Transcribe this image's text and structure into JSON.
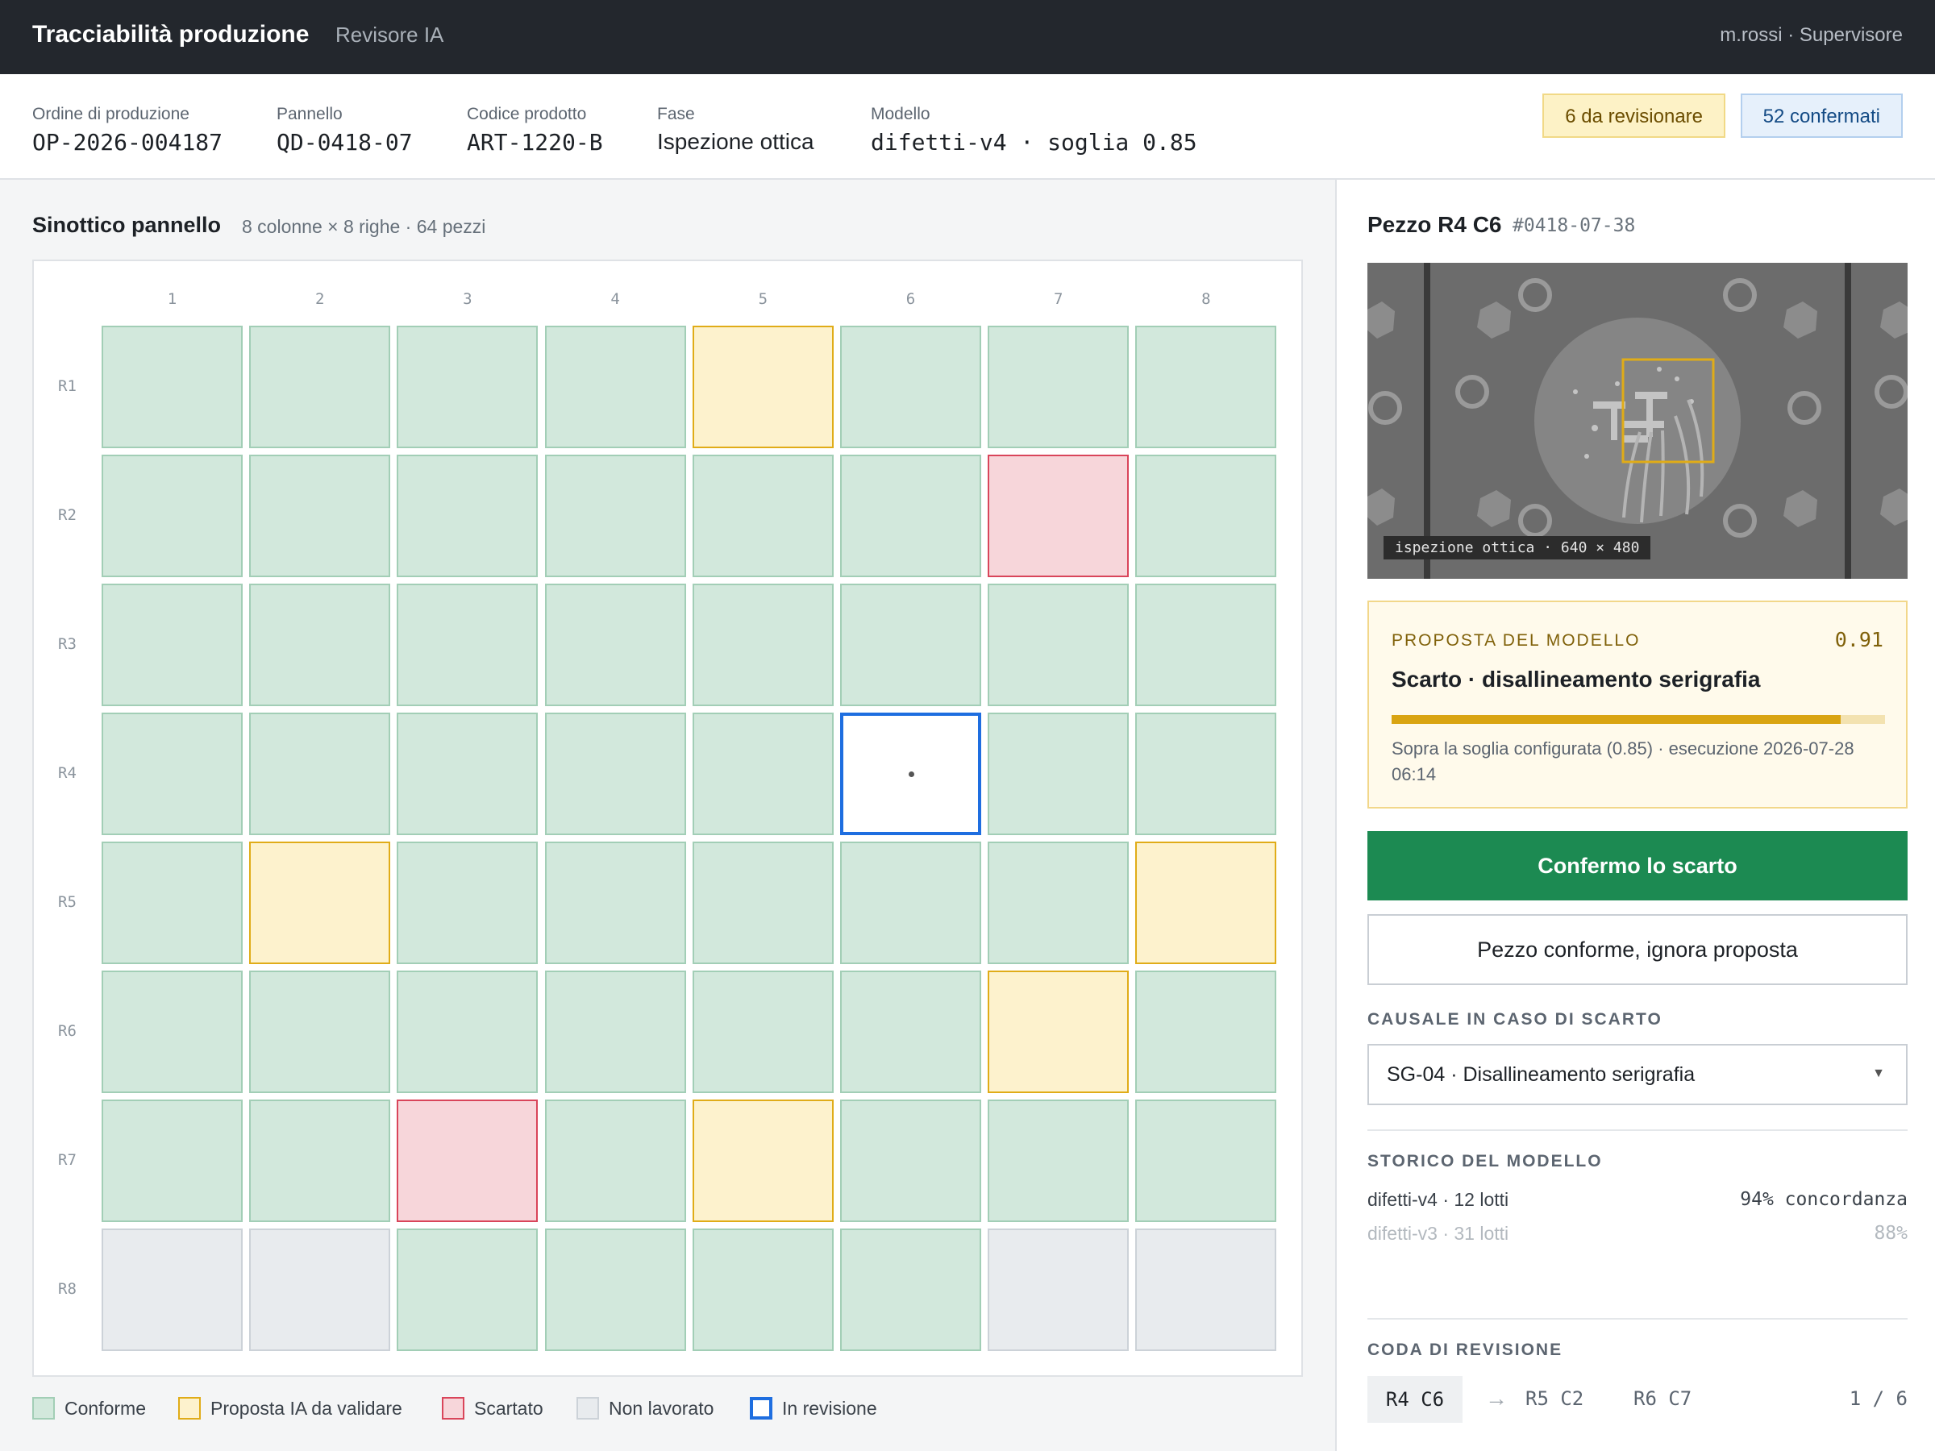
{
  "app": {
    "title": "Tracciabilità produzione",
    "nav_link": "Revisore IA",
    "user": "m.rossi · Supervisore"
  },
  "order": {
    "fields": [
      {
        "label": "Ordine di produzione",
        "value": "OP-2026-004187"
      },
      {
        "label": "Pannello",
        "value": "QD-0418-07"
      },
      {
        "label": "Codice prodotto",
        "value": "ART-1220-B"
      },
      {
        "label": "Fase",
        "value": "Ispezione ottica"
      },
      {
        "label": "Modello",
        "value": "difetti-v4 · soglia 0.85"
      }
    ],
    "to_review": "6 da revisionare",
    "confirmed": "52 confermati"
  },
  "panel": {
    "title": "Sinottico pannello",
    "subtitle": "8 colonne × 8 righe · 64 pezzi",
    "columns": [
      "1",
      "2",
      "3",
      "4",
      "5",
      "6",
      "7",
      "8"
    ],
    "rows": [
      "R1",
      "R2",
      "R3",
      "R4",
      "R5",
      "R6",
      "R7",
      "R8"
    ],
    "grid": [
      [
        "ok",
        "ok",
        "ok",
        "ok",
        "ai",
        "ok",
        "ok",
        "ok"
      ],
      [
        "ok",
        "ok",
        "ok",
        "ok",
        "ok",
        "ok",
        "rej",
        "ok"
      ],
      [
        "ok",
        "ok",
        "ok",
        "ok",
        "ok",
        "ok",
        "ok",
        "ok"
      ],
      [
        "ok",
        "ok",
        "ok",
        "ok",
        "ok",
        "rev",
        "ok",
        "ok"
      ],
      [
        "ok",
        "ai",
        "ok",
        "ok",
        "ok",
        "ok",
        "ok",
        "ai"
      ],
      [
        "ok",
        "ok",
        "ok",
        "ok",
        "ok",
        "ok",
        "ai",
        "ok"
      ],
      [
        "ok",
        "ok",
        "rej",
        "ok",
        "ai",
        "ok",
        "ok",
        "ok"
      ],
      [
        "na",
        "na",
        "ok",
        "ok",
        "ok",
        "ok",
        "na",
        "na"
      ]
    ]
  },
  "legend": [
    {
      "key": "ok",
      "label": "Conforme"
    },
    {
      "key": "ai",
      "label": "Proposta IA da validare"
    },
    {
      "key": "rej",
      "label": "Scartato"
    },
    {
      "key": "na",
      "label": "Non lavorato"
    },
    {
      "key": "rev",
      "label": "In revisione"
    }
  ],
  "piece": {
    "title": "Pezzo R4 C6",
    "id": "#0418-07-38",
    "image_caption": "ispezione ottica · 640 × 480"
  },
  "proposal": {
    "label": "PROPOSTA DEL MODELLO",
    "score": "0.91",
    "confidence": 0.91,
    "headline": "Scarto · disallineamento serigrafia",
    "note": "Sopra la soglia configurata (0.85) · esecuzione 2026-07-28 06:14"
  },
  "actions": {
    "confirm": "Confermo lo scarto",
    "ignore": "Pezzo conforme, ignora proposta"
  },
  "cause": {
    "label": "CAUSALE IN CASO DI SCARTO",
    "selected": "SG-04 · Disallineamento serigrafia"
  },
  "history": {
    "label": "STORICO DEL MODELLO",
    "rows": [
      {
        "model": "difetti-v4 · 12 lotti",
        "score": "94% concordanza"
      },
      {
        "model": "difetti-v3 · 31 lotti",
        "score": "88%"
      }
    ]
  },
  "queue": {
    "label": "CODA DI REVISIONE",
    "current": "R4 C6",
    "arrow": "→",
    "next": [
      "R5 C2",
      "R6 C7"
    ],
    "count": "1 / 6"
  },
  "colors": {
    "conforme": "#d2e8dc",
    "proposta": "#fdf2cd",
    "scartato": "#f7d6da",
    "non_lavorato": "#e8ebee",
    "in_revisione": "#1e6ee0",
    "confirm_button": "#1c8a52"
  }
}
